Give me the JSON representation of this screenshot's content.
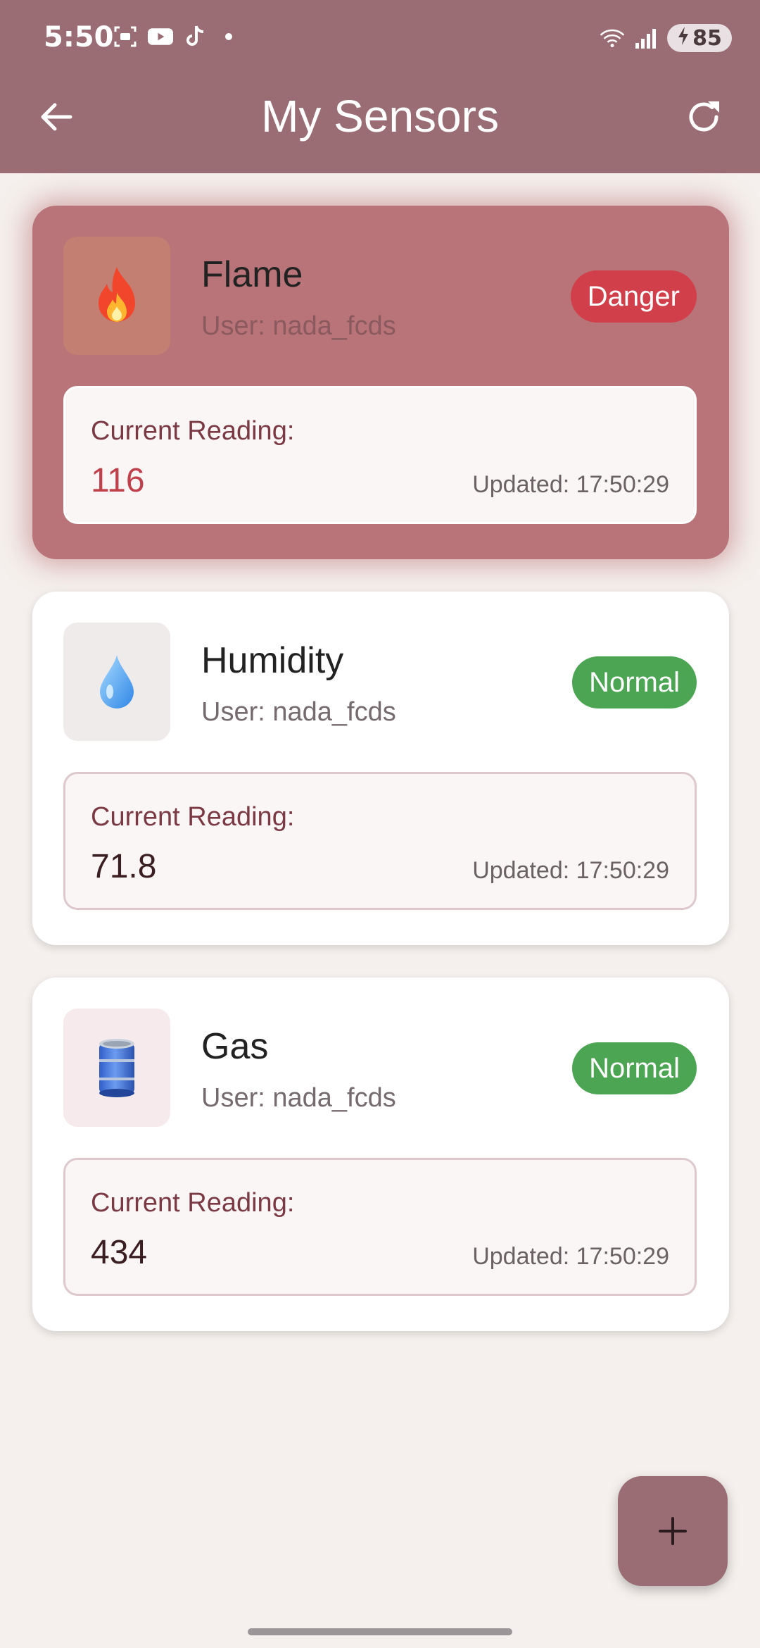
{
  "status_bar": {
    "time": "5:50",
    "battery": "85"
  },
  "app_bar": {
    "title": "My Sensors"
  },
  "sensors": [
    {
      "name": "Flame",
      "user": "User: nada_fcds",
      "status": "Danger",
      "reading_label": "Current Reading:",
      "value": "116",
      "updated": "Updated: 17:50:29",
      "icon": "fire-icon"
    },
    {
      "name": "Humidity",
      "user": "User: nada_fcds",
      "status": "Normal",
      "reading_label": "Current Reading:",
      "value": "71.8",
      "updated": "Updated: 17:50:29",
      "icon": "droplet-icon"
    },
    {
      "name": "Gas",
      "user": "User: nada_fcds",
      "status": "Normal",
      "reading_label": "Current Reading:",
      "value": "434",
      "updated": "Updated: 17:50:29",
      "icon": "gas-barrel-icon"
    }
  ],
  "colors": {
    "primary": "#9a6d74",
    "danger_card": "#b97479",
    "danger_badge": "#d13f4a",
    "normal_badge": "#4ca552",
    "background": "#f5f0ed"
  }
}
